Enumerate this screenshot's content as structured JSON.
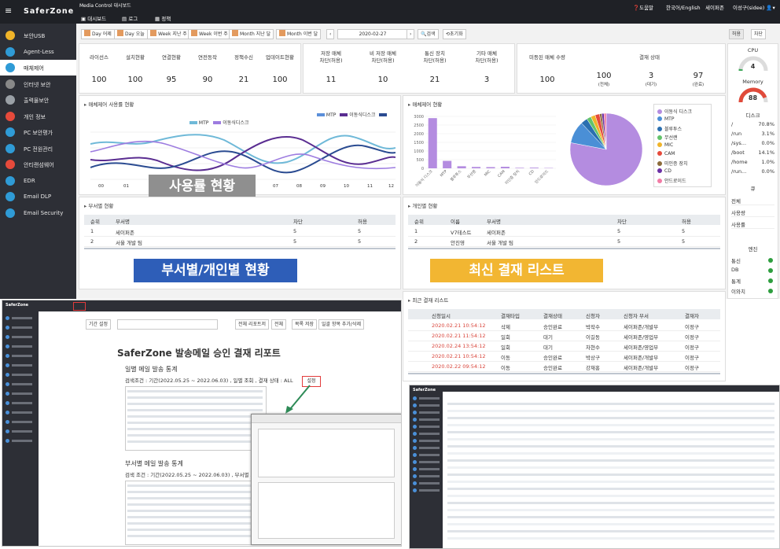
{
  "app": {
    "brand": "SaferZone",
    "crumb": "Media Control  대시보드",
    "tabs": [
      "대시보드",
      "로그",
      "정책"
    ],
    "top_right": [
      "도움말",
      "한국어/English",
      "세이퍼존",
      "이성구(sidee)"
    ]
  },
  "sidebar": [
    {
      "label": "보안USB",
      "color": "#f0b429"
    },
    {
      "label": "Agent-Less",
      "color": "#2f9bd6"
    },
    {
      "label": "매체제어",
      "color": "#2f9bd6",
      "active": true
    },
    {
      "label": "인터넷 보안",
      "color": "#888888"
    },
    {
      "label": "출력물보안",
      "color": "#9aa0a6"
    },
    {
      "label": "개인 정보",
      "color": "#e64a3b"
    },
    {
      "label": "PC 보안평가",
      "color": "#2f9bd6"
    },
    {
      "label": "PC 전원관리",
      "color": "#2f9bd6"
    },
    {
      "label": "안티랜섬웨어",
      "color": "#e64a3b"
    },
    {
      "label": "EDR",
      "color": "#2f9bd6"
    },
    {
      "label": "Email DLP",
      "color": "#2f9bd6"
    },
    {
      "label": "Email Security",
      "color": "#2f9bd6"
    }
  ],
  "filters": {
    "buttons": [
      "Day 어제",
      "Day 오늘",
      "Week 지난 주",
      "Week 이번 주",
      "Month 지난 달",
      "Month 이번 달"
    ],
    "date": "2020-02-27",
    "search": "검색",
    "reset": "초기화",
    "toggle": [
      "허용",
      "차단"
    ]
  },
  "stats": {
    "headers1": [
      "라이선스",
      "설치현황",
      "연결현황",
      "연전동작",
      "정책수신",
      "업데이트현황"
    ],
    "values1": [
      "100",
      "100",
      "95",
      "90",
      "21",
      "100"
    ],
    "headers2": [
      "저장 매체\n차단(허용)",
      "비 저장 매체\n차단(허용)",
      "통신 장치\n차단(허용)",
      "기타 매체\n차단(허용)"
    ],
    "values2": [
      "11",
      "10",
      "21",
      "3"
    ],
    "registered_label": "미등된 매체 수량",
    "registered_value": "100",
    "approval_label": "결재 상태",
    "approval": [
      {
        "value": "100",
        "sub": "(전체)"
      },
      {
        "value": "3",
        "sub": "(대기)"
      },
      {
        "value": "97",
        "sub": "(완료)"
      }
    ]
  },
  "usage_panel": {
    "title": "매체제어 사용률 현황",
    "legend_a": [
      "MTP",
      "이동식디스크"
    ],
    "legend_b": [
      "MTP",
      "이동식디스크"
    ],
    "overlay": "사용률 현황",
    "x_ticks": [
      "00",
      "01",
      "07",
      "08",
      "09",
      "10",
      "11",
      "12"
    ]
  },
  "chart_data": [
    {
      "type": "bar",
      "title": "매체제어 현황",
      "categories": [
        "이동식 디스크",
        "MTP",
        "블루투스",
        "무선랜",
        "MIC",
        "CAM",
        "미인증 장치",
        "CD",
        "안드로이드"
      ],
      "values": [
        2900,
        430,
        120,
        80,
        70,
        90,
        30,
        40,
        20
      ],
      "ylim": [
        0,
        3000
      ],
      "y_ticks": [
        "0",
        "500",
        "1000",
        "1500",
        "2000",
        "2500",
        "3000"
      ]
    },
    {
      "type": "pie",
      "categories": [
        "이동식 디스크",
        "MTP",
        "블루투스",
        "무선랜",
        "MIC",
        "CAM",
        "미인증 장치",
        "CD",
        "안드로이드"
      ],
      "values": [
        78,
        10,
        3,
        2,
        2,
        2,
        1,
        1,
        1
      ],
      "colors": [
        "#b48ce0",
        "#4a8fd6",
        "#2a6fb0",
        "#63c36b",
        "#f0b429",
        "#e64a3b",
        "#8b6b3a",
        "#6b2fa5",
        "#f27ba5"
      ]
    }
  ],
  "dept_panel": {
    "title": "부서별 현황",
    "headers": [
      "순위",
      "부서명",
      "차단",
      "허용"
    ],
    "rows": [
      [
        "1",
        "세이퍼존",
        "5",
        "5"
      ],
      [
        "2",
        "서울 개발 팀",
        "5",
        "5"
      ]
    ],
    "overlay": "부서별/개인별 현황"
  },
  "person_panel": {
    "title": "개인별 현황",
    "headers": [
      "순위",
      "이름",
      "부서명",
      "차단",
      "허용"
    ],
    "rows": [
      [
        "1",
        "V7테스트",
        "세이퍼존",
        "5",
        "5"
      ],
      [
        "2",
        "안진영",
        "서울 개발 팀",
        "5",
        "5"
      ]
    ],
    "overlay": "최신 결재 리스트"
  },
  "recent_panel": {
    "title": "최근 결재 리스트",
    "headers": [
      "신청일시",
      "결재타입",
      "결재상태",
      "신청자",
      "신청자 부서",
      "결재자"
    ],
    "rows": [
      [
        "2020.02.21 10:54:12",
        "삭제",
        "승인완료",
        "박작수",
        "세이퍼존/개발부",
        "이정구"
      ],
      [
        "2020.02.21 11:54:12",
        "일회",
        "대기",
        "이길동",
        "세이퍼존/영업부",
        "이정구"
      ],
      [
        "2020.02.24 13:54:12",
        "일회",
        "대기",
        "차현수",
        "세이퍼존/영업부",
        "이정구"
      ],
      [
        "2020.02.21 10:54:12",
        "이동",
        "승인완료",
        "박상구",
        "세이퍼존/개발부",
        "이정구"
      ],
      [
        "2020.02.22 09:54:12",
        "이동",
        "승인완료",
        "강재홍",
        "세이퍼존/개발부",
        "이정구"
      ]
    ]
  },
  "system": {
    "cpu_label": "CPU",
    "cpu_value": "4",
    "cpu_level": 0.04,
    "memory_label": "Memory",
    "memory_value": "88",
    "memory_level": 0.88,
    "disk_label": "디스크",
    "disks": [
      [
        "/",
        "70.8%"
      ],
      [
        "/run",
        "3.1%"
      ],
      [
        "/sys...",
        "0.0%"
      ],
      [
        "/boot",
        "14.1%"
      ],
      [
        "/home",
        "1.0%"
      ],
      [
        "/run...",
        "0.0%"
      ]
    ],
    "queue_label": "큐",
    "queue": [
      "전체",
      "사용량",
      "사용률"
    ],
    "engine_label": "엔진",
    "engines": [
      "통신",
      "DB",
      "통계",
      "이와치"
    ]
  },
  "report": {
    "title": "SaferZone 발송메일 승인 결재 리포트",
    "section1": "일별 메일 발송 통계",
    "cond1": "검색조건 : 기간(2022.05.25 ~ 2022.06.03) , 일별 조회 , 결재 상태 : ALL",
    "section2": "부서별 메일 발송 통계",
    "cond2": "검색 조건 : 기간(2022.05.25 ~ 2022.06.03) , 부서별 조회(Top",
    "setting_label": "설정",
    "period_label": "기간 설정",
    "buttons": [
      "전체 리포트저",
      "전체",
      "목록 저장",
      "일괄 항목 추가/삭제"
    ]
  }
}
